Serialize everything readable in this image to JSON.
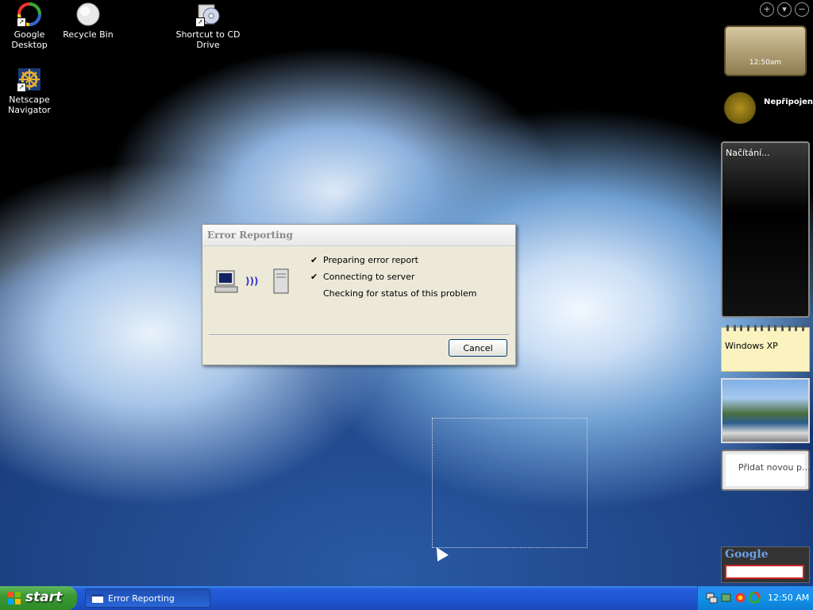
{
  "desktop": {
    "icons": [
      {
        "label_line1": "Google",
        "label_line2": "Desktop",
        "icon": "google-desktop-icon"
      },
      {
        "label_line1": "Recycle Bin",
        "label_line2": "",
        "icon": "recycle-bin-icon"
      },
      {
        "label_line1": "Shortcut to CD",
        "label_line2": "Drive",
        "icon": "cd-drive-icon"
      },
      {
        "label_line1": "Netscape",
        "label_line2": "Navigator",
        "icon": "netscape-navigator-icon"
      }
    ]
  },
  "dialog": {
    "title": "Error Reporting",
    "steps": [
      {
        "check": "✔",
        "text": "Preparing error report"
      },
      {
        "check": "✔",
        "text": "Connecting to server"
      },
      {
        "check": "",
        "text": "Checking for status of this problem"
      }
    ],
    "cancel_label": "Cancel",
    "icons": [
      "computer-icon",
      "signal-waves-icon",
      "server-icon"
    ]
  },
  "sidebar": {
    "controls": [
      "+",
      "▾",
      "−"
    ],
    "clock_time": "12:50am",
    "weather_text": "Nepřipojeno",
    "news_text": "Načítání...",
    "notes_text": "Windows XP",
    "add_text": "Přidat novou p...",
    "google_logo": "Google"
  },
  "taskbar": {
    "start_label": "start",
    "task_label": "Error Reporting",
    "clock": "12:50 AM"
  },
  "colors": {
    "taskbar_blue": "#245edb",
    "start_green": "#3a9a35",
    "dialog_bg": "#ece9d8"
  }
}
